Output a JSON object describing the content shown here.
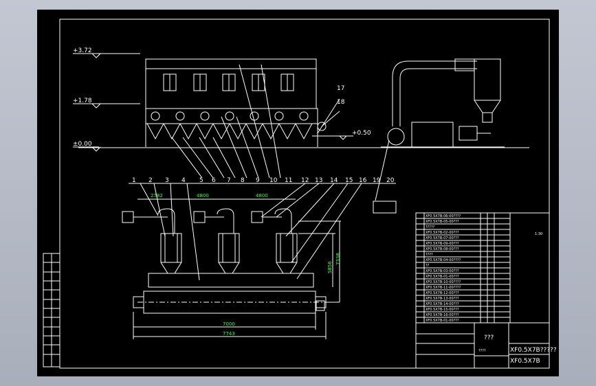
{
  "elevations": [
    "+3.72",
    "+1.78",
    "±0.00",
    "+0.50"
  ],
  "part_numbers_top": [
    "1",
    "2",
    "3",
    "4",
    "5",
    "6",
    "7",
    "8",
    "9",
    "10",
    "11",
    "12",
    "13",
    "14",
    "15",
    "16",
    "19",
    "20"
  ],
  "part_numbers_side": [
    "17",
    "18"
  ],
  "dimensions": {
    "d1": "2782",
    "d2": "4800",
    "d3": "4800",
    "d4": "5856",
    "d5": "7338",
    "d6": "7000",
    "d7": "7743"
  },
  "title_block": {
    "name_unknown": "???",
    "drawing_code_a": "XF0.5X7B?????",
    "drawing_code_b": "XF0.5X7B",
    "label_lower": "????",
    "label_scale": "1:30"
  },
  "bom_rows": [
    "XF0.5X7B-06-00????",
    "XF0.5X7B-05-00???",
    "?????",
    "XF0.5X7B-02-00???",
    "XF0.5X7B-07-00???",
    "XF0.5X7B-09-00???",
    "XF0.5X7B-08-00???",
    "????",
    "XF0.5X7B-04-00????",
    "??",
    "XF0.5X7B-03-00???",
    "XF0.5X7B-01-00???",
    "XF0.5X7B-10-00????",
    "XF0.5X7B-11-00????",
    "XF0.5X7B-12-00???",
    "XF0.5X7B-13-00???",
    "XF0.5X7B-14-00???",
    "XF0.5X7B-15-00???",
    "XF0.5X7B-16-00???",
    "XF0.5X7B-01-00???"
  ]
}
